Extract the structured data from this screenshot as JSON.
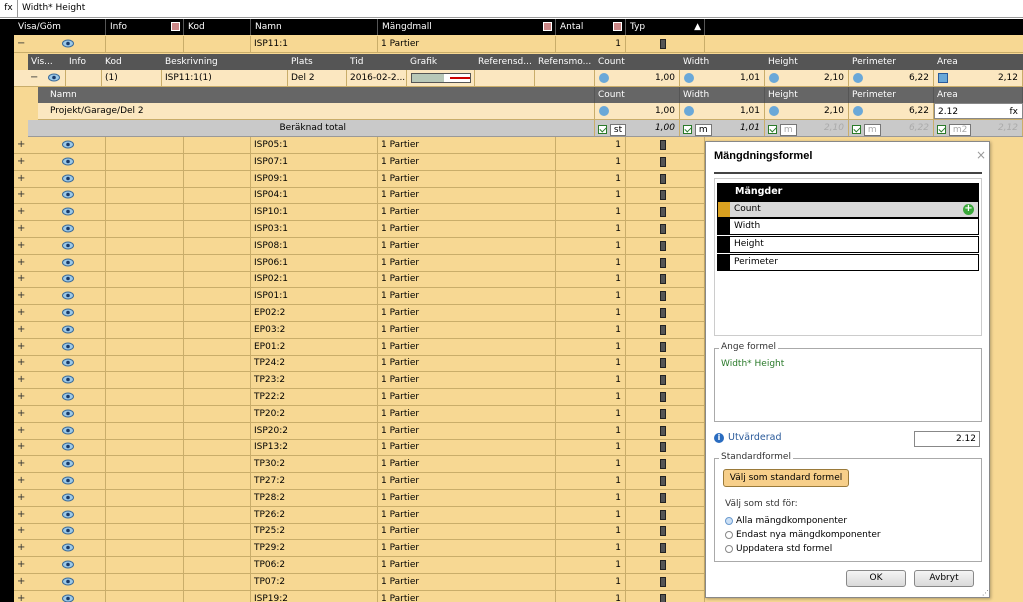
{
  "formula_bar": {
    "label": "fx",
    "value": "Width* Height"
  },
  "columns": {
    "visa": "Visa/Göm",
    "info": "Info",
    "kod": "Kod",
    "namn": "Namn",
    "mangdmall": "Mängdmall",
    "antal": "Antal",
    "typ": "Typ",
    "sort_arrow": "▲"
  },
  "expanded_row": {
    "namn": "ISP11:1",
    "mangdmall": "1 Partier",
    "antal": "1",
    "toggle": "−"
  },
  "sub_columns": {
    "vis": "Vis...",
    "info": "Info",
    "kod": "Kod",
    "beskrivning": "Beskrivning",
    "plats": "Plats",
    "tid": "Tid",
    "grafik": "Grafik",
    "referensd": "Referensd...",
    "refensmo": "Refensmo...",
    "count": "Count",
    "width": "Width",
    "height": "Height",
    "perimeter": "Perimeter",
    "area": "Area"
  },
  "sub_row": {
    "toggle": "−",
    "kod": "(1)",
    "beskrivning": "ISP11:1(1)",
    "plats": "Del 2",
    "tid": "2016-02-2...",
    "count": "1,00",
    "width": "1,01",
    "height": "2,10",
    "perimeter": "6,22",
    "area": "2,12"
  },
  "detail_columns": {
    "namn": "Namn",
    "count": "Count",
    "width": "Width",
    "height": "Height",
    "perimeter": "Perimeter",
    "area": "Area"
  },
  "detail_row": {
    "namn": "Projekt/Garage/Del 2",
    "count": "1,00",
    "width": "1,01",
    "height": "2,10",
    "perimeter": "6,22",
    "area_edit": "2.12",
    "fx": "fx"
  },
  "total_row": {
    "label": "Beräknad total",
    "count_unit": "st",
    "count": "1,00",
    "width_unit": "m",
    "width": "1,01",
    "height_unit": "m",
    "height": "2,10",
    "perimeter_unit": "m",
    "perimeter": "6,22",
    "area_unit": "m2",
    "area": "2,12"
  },
  "rows": [
    {
      "namn": "ISP05:1",
      "mangdmall": "1 Partier",
      "antal": "1"
    },
    {
      "namn": "ISP07:1",
      "mangdmall": "1 Partier",
      "antal": "1"
    },
    {
      "namn": "ISP09:1",
      "mangdmall": "1 Partier",
      "antal": "1"
    },
    {
      "namn": "ISP04:1",
      "mangdmall": "1 Partier",
      "antal": "1"
    },
    {
      "namn": "ISP10:1",
      "mangdmall": "1 Partier",
      "antal": "1"
    },
    {
      "namn": "ISP03:1",
      "mangdmall": "1 Partier",
      "antal": "1"
    },
    {
      "namn": "ISP08:1",
      "mangdmall": "1 Partier",
      "antal": "1"
    },
    {
      "namn": "ISP06:1",
      "mangdmall": "1 Partier",
      "antal": "1"
    },
    {
      "namn": "ISP02:1",
      "mangdmall": "1 Partier",
      "antal": "1"
    },
    {
      "namn": "ISP01:1",
      "mangdmall": "1 Partier",
      "antal": "1"
    },
    {
      "namn": "EP02:2",
      "mangdmall": "1 Partier",
      "antal": "1"
    },
    {
      "namn": "EP03:2",
      "mangdmall": "1 Partier",
      "antal": "1"
    },
    {
      "namn": "EP01:2",
      "mangdmall": "1 Partier",
      "antal": "1"
    },
    {
      "namn": "TP24:2",
      "mangdmall": "1 Partier",
      "antal": "1"
    },
    {
      "namn": "TP23:2",
      "mangdmall": "1 Partier",
      "antal": "1"
    },
    {
      "namn": "TP22:2",
      "mangdmall": "1 Partier",
      "antal": "1"
    },
    {
      "namn": "TP20:2",
      "mangdmall": "1 Partier",
      "antal": "1"
    },
    {
      "namn": "ISP20:2",
      "mangdmall": "1 Partier",
      "antal": "1"
    },
    {
      "namn": "ISP13:2",
      "mangdmall": "1 Partier",
      "antal": "1"
    },
    {
      "namn": "TP30:2",
      "mangdmall": "1 Partier",
      "antal": "1"
    },
    {
      "namn": "TP27:2",
      "mangdmall": "1 Partier",
      "antal": "1"
    },
    {
      "namn": "TP28:2",
      "mangdmall": "1 Partier",
      "antal": "1"
    },
    {
      "namn": "TP26:2",
      "mangdmall": "1 Partier",
      "antal": "1"
    },
    {
      "namn": "TP25:2",
      "mangdmall": "1 Partier",
      "antal": "1"
    },
    {
      "namn": "TP29:2",
      "mangdmall": "1 Partier",
      "antal": "1"
    },
    {
      "namn": "TP06:2",
      "mangdmall": "1 Partier",
      "antal": "1"
    },
    {
      "namn": "TP07:2",
      "mangdmall": "1 Partier",
      "antal": "1"
    },
    {
      "namn": "ISP19:2",
      "mangdmall": "1 Partier",
      "antal": "1"
    }
  ],
  "dialog": {
    "title": "Mängdningsformel",
    "close": "×",
    "quantities_header": "Mängder",
    "quantities": [
      "Count",
      "Width",
      "Height",
      "Perimeter"
    ],
    "formula_legend": "Ange formel",
    "formula": "Width* Height",
    "evaluated_label": "Utvärderad",
    "evaluated_value": "2.12",
    "info_glyph": "i",
    "std_legend": "Standardformel",
    "std_button": "Välj som standard formel",
    "std_for_label": "Välj som std för:",
    "radios": [
      "Alla mängdkomponenter",
      "Endast nya mängdkomponenter",
      "Uppdatera std formel"
    ],
    "ok": "OK",
    "cancel": "Avbryt"
  },
  "colors": {
    "row_bg": "#f7d893",
    "header_bg": "#000000",
    "subrow_bg": "#fbe7c0",
    "accent_green": "#2a7a2a"
  }
}
